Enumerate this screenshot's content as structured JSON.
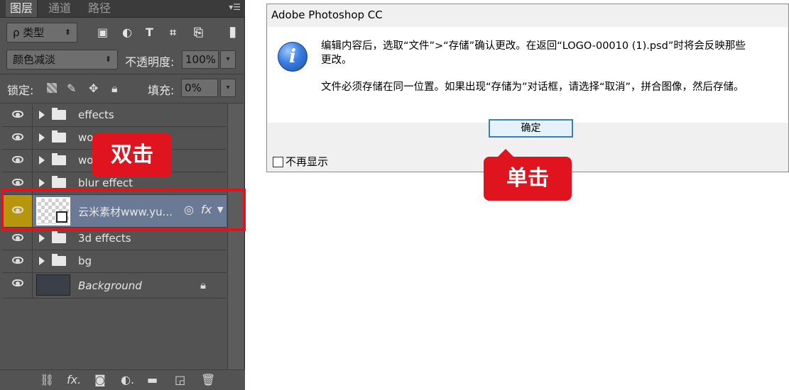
{
  "panel": {
    "tabs": [
      "图层",
      "通道",
      "路径"
    ],
    "filter_label": "ρ 类型",
    "blend_mode": "颜色减淡",
    "opacity_label": "不透明度:",
    "opacity_value": "100%",
    "lock_label": "锁定:",
    "fill_label": "填充:",
    "fill_value": "0%",
    "layers": [
      {
        "name": "effects",
        "type": "group"
      },
      {
        "name": "wo",
        "type": "group"
      },
      {
        "name": "wo",
        "type": "group"
      },
      {
        "name": "blur effect",
        "type": "group"
      },
      {
        "name": "云米素材www.yu...",
        "type": "smart",
        "selected": true
      },
      {
        "name": "3d effects",
        "type": "group"
      },
      {
        "name": "bg",
        "type": "group"
      },
      {
        "name": "Background",
        "type": "background"
      }
    ]
  },
  "annotations": {
    "double_click": "双击",
    "single_click": "单击"
  },
  "dialog": {
    "title": "Adobe Photoshop CC",
    "message_line1": "编辑内容后，选取“文件”>“存储”确认更改。在返回“LOGO-00010 (1).psd”时将会反映那些",
    "message_line2": "更改。",
    "message_line3": "文件必须存储在同一位置。如果出现“存储为”对话框，请选择“取消”，拼合图像，然后存储。",
    "ok_label": "确定",
    "checkbox_label": "不再显示"
  },
  "colors": {
    "annotation_red": "#e0141e",
    "selected_layer": "#6a7a94",
    "eye_highlight": "#b8960c"
  }
}
